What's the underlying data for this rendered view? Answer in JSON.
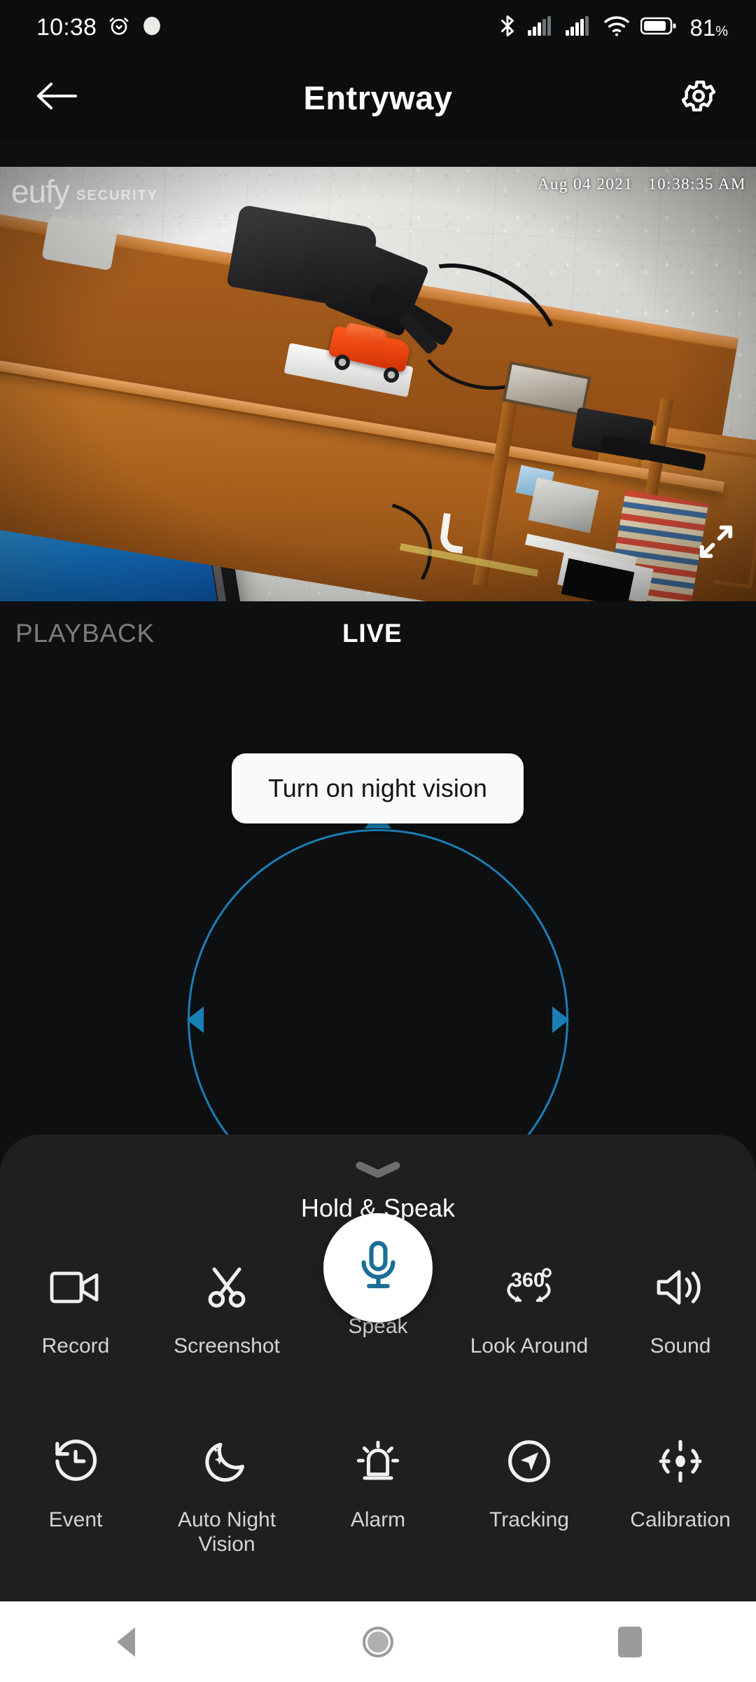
{
  "status_bar": {
    "clock": "10:38",
    "alarm_icon": "alarm-clock-icon",
    "dot_icon": "recording-dot-icon",
    "bluetooth_icon": "bluetooth-icon",
    "signal_1_icon": "cellular-signal-icon",
    "signal_2_icon": "cellular-signal-icon",
    "wifi_icon": "wifi-icon",
    "battery_icon": "battery-icon",
    "battery_level": "81",
    "battery_unit": "%"
  },
  "header": {
    "back_icon": "back-arrow-icon",
    "title": "Entryway",
    "settings_icon": "gear-icon"
  },
  "video": {
    "watermark_brand": "eufy",
    "watermark_sub": "SECURITY",
    "timestamp": "Aug 04 2021   10:38:35 AM",
    "fullscreen_icon": "fullscreen-expand-icon"
  },
  "tabs": [
    {
      "label": "PLAYBACK",
      "active": false
    },
    {
      "label": "LIVE",
      "active": true
    }
  ],
  "tooltip": {
    "text": "Turn on night vision"
  },
  "ptz": {
    "up_icon": "triangle-up-icon",
    "left_icon": "triangle-left-icon",
    "right_icon": "triangle-right-icon",
    "accent_color": "#1a7fb5"
  },
  "sheet": {
    "handle_icon": "chevron-down-icon",
    "hold_speak_label": "Hold & Speak",
    "row1": [
      {
        "label": "Record",
        "icon": "video-camera-icon"
      },
      {
        "label": "Screenshot",
        "icon": "scissors-icon"
      },
      {
        "label": "Speak",
        "icon": "microphone-icon",
        "highlighted": true
      },
      {
        "label": "Look Around",
        "icon": "360-degrees-icon",
        "badge": "360",
        "badge_unit": "°"
      },
      {
        "label": "Sound",
        "icon": "speaker-volume-icon"
      }
    ],
    "row2": [
      {
        "label": "Event",
        "icon": "history-clock-icon"
      },
      {
        "label": "Auto Night Vision",
        "icon": "moon-stars-icon"
      },
      {
        "label": "Alarm",
        "icon": "siren-icon"
      },
      {
        "label": "Tracking",
        "icon": "navigation-arrow-icon"
      },
      {
        "label": "Calibration",
        "icon": "crosshair-target-icon"
      }
    ]
  },
  "navbar": {
    "back_icon": "nav-back-icon",
    "home_icon": "nav-home-icon",
    "recents_icon": "nav-recents-icon"
  },
  "colors": {
    "background": "#0d0f11",
    "sheet": "#1f1f20",
    "accent": "#1a7fb5",
    "mic_teal": "#1c6e96",
    "text_primary": "#ffffff",
    "text_secondary": "#d4d4d4",
    "tab_inactive": "#7d7d7d"
  }
}
